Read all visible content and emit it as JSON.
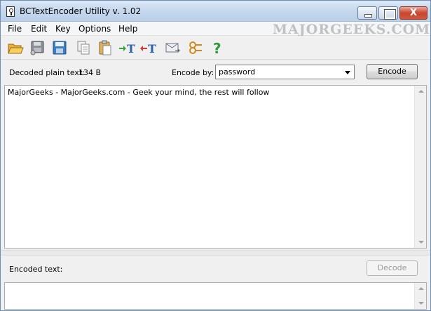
{
  "window": {
    "title": "BCTextEncoder Utility v. 1.02",
    "close_glyph": "X",
    "watermark": "MAJORGEEKS.COM"
  },
  "menu": {
    "items": [
      "File",
      "Edit",
      "Key",
      "Options",
      "Help"
    ]
  },
  "toolbar": {
    "icons": [
      "open-folder-icon",
      "open-disk-icon",
      "save-icon",
      "copy-icon",
      "paste-icon",
      "encode-text-icon",
      "decode-text-icon",
      "email-icon",
      "key-icon",
      "help-icon"
    ]
  },
  "decoded": {
    "label": "Decoded plain text:",
    "size": "134 B",
    "encode_by_label": "Encode by:",
    "encode_by_value": "password",
    "encode_button": "Encode",
    "text": "MajorGeeks - MajorGeeks.com - Geek your mind, the rest will follow"
  },
  "encoded": {
    "label": "Encoded text:",
    "decode_button": "Decode",
    "text": ""
  },
  "colors": {
    "title_gradient_top": "#dbe8f6",
    "close_button": "#c9452f",
    "face": "#f0f0f0"
  }
}
